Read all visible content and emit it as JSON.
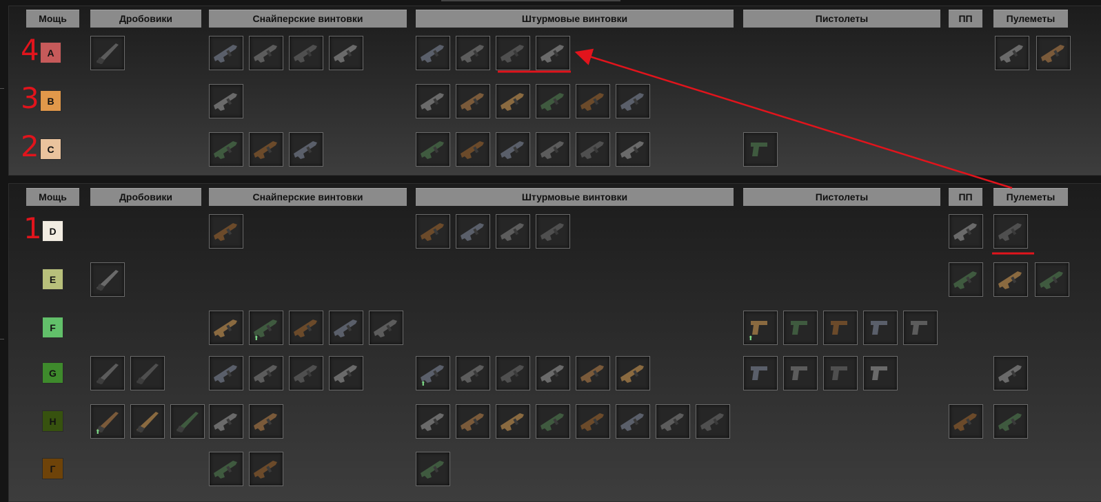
{
  "columns": [
    {
      "key": "power",
      "label": "Мощь"
    },
    {
      "key": "shotguns",
      "label": "Дробовики"
    },
    {
      "key": "snipers",
      "label": "Снайперские винтовки"
    },
    {
      "key": "assault",
      "label": "Штурмовые винтовки"
    },
    {
      "key": "pistols",
      "label": "Пистолеты"
    },
    {
      "key": "smg",
      "label": "ПП"
    },
    {
      "key": "mg",
      "label": "Пулеметы"
    }
  ],
  "panels": [
    {
      "tiers": [
        {
          "label": "A",
          "color": "#c65a5a",
          "counts": {
            "shotguns": 1,
            "snipers": 4,
            "assault": 4,
            "pistols": 0,
            "smg": 0,
            "mg": 2
          },
          "mark": "4"
        },
        {
          "label": "B",
          "color": "#e1984a",
          "counts": {
            "shotguns": 0,
            "snipers": 1,
            "assault": 6,
            "pistols": 0,
            "smg": 0,
            "mg": 0
          },
          "mark": "3"
        },
        {
          "label": "C",
          "color": "#eac39d",
          "counts": {
            "shotguns": 0,
            "snipers": 3,
            "assault": 6,
            "pistols": 1,
            "smg": 0,
            "mg": 0
          },
          "mark": "2"
        }
      ]
    },
    {
      "tiers": [
        {
          "label": "D",
          "color": "#f2ece2",
          "counts": {
            "shotguns": 0,
            "snipers": 1,
            "assault": 4,
            "pistols": 0,
            "smg": 1,
            "mg": 1
          },
          "mark": "1"
        },
        {
          "label": "E",
          "color": "#b8c07b",
          "counts": {
            "shotguns": 1,
            "snipers": 0,
            "assault": 0,
            "pistols": 0,
            "smg": 1,
            "mg": 2
          },
          "mark": ""
        },
        {
          "label": "F",
          "color": "#62c06a",
          "counts": {
            "shotguns": 0,
            "snipers": 5,
            "assault": 0,
            "pistols": 5,
            "smg": 0,
            "mg": 0
          },
          "mark": ""
        },
        {
          "label": "G",
          "color": "#3e8a2c",
          "counts": {
            "shotguns": 2,
            "snipers": 4,
            "assault": 6,
            "pistols": 4,
            "smg": 0,
            "mg": 1
          },
          "mark": ""
        },
        {
          "label": "H",
          "color": "#37520f",
          "counts": {
            "shotguns": 3,
            "snipers": 2,
            "assault": 8,
            "pistols": 0,
            "smg": 1,
            "mg": 1
          },
          "mark": ""
        },
        {
          "label": "Г",
          "color": "#6e4309",
          "counts": {
            "shotguns": 0,
            "snipers": 2,
            "assault": 1,
            "pistols": 0,
            "smg": 0,
            "mg": 0
          },
          "mark": ""
        }
      ]
    }
  ],
  "icons": [
    "rifle-icon",
    "shotgun-icon",
    "sniper-rifle-icon",
    "pistol-icon",
    "smg-icon",
    "machine-gun-icon",
    "upgrade-arrow-icon"
  ],
  "colors": {
    "annotation": "#e1141c",
    "header_bg": "#8b8b8b"
  }
}
